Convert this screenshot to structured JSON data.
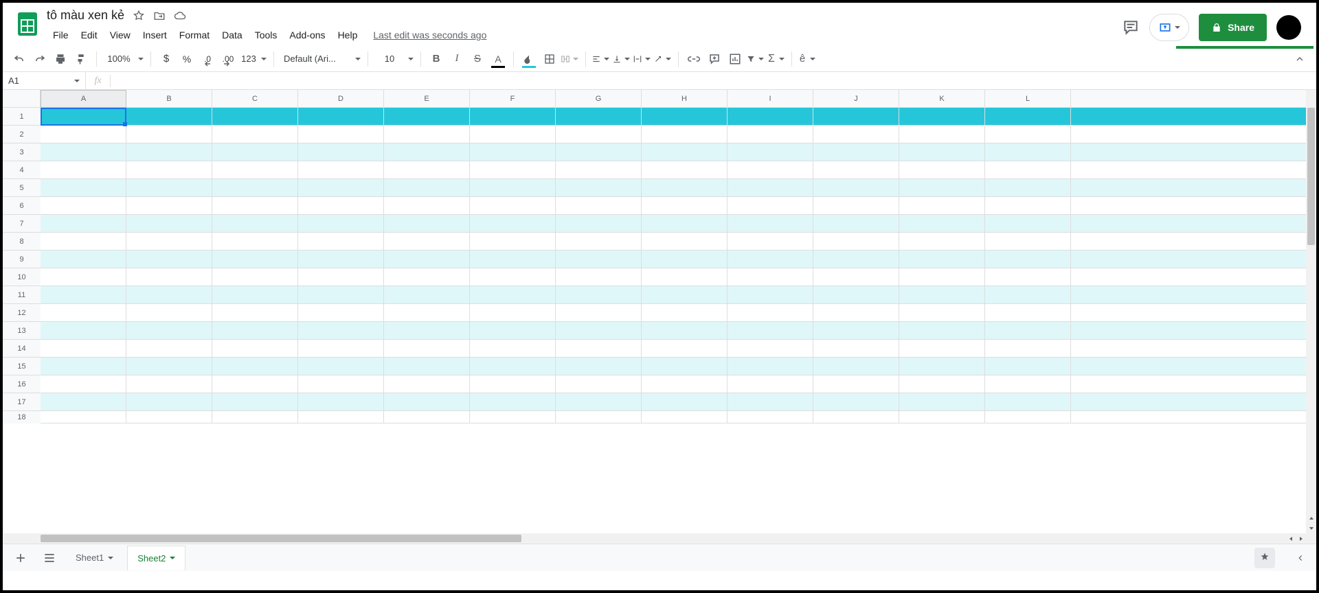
{
  "doc": {
    "title": "tô màu xen kẻ"
  },
  "menus": {
    "file": "File",
    "edit": "Edit",
    "view": "View",
    "insert": "Insert",
    "format": "Format",
    "data": "Data",
    "tools": "Tools",
    "addons": "Add-ons",
    "help": "Help"
  },
  "last_edit": "Last edit was seconds ago",
  "header_buttons": {
    "share": "Share"
  },
  "toolbar": {
    "zoom": "100%",
    "currency": "$",
    "percent": "%",
    "dec_dec": ".0",
    "inc_dec": ".00",
    "num_fmt": "123",
    "font": "Default (Ari...",
    "font_size": "10"
  },
  "icons": {
    "accent_hat": "ê",
    "text_A": "A"
  },
  "name_box": "A1",
  "fx": "",
  "columns": [
    "A",
    "B",
    "C",
    "D",
    "E",
    "F",
    "G",
    "H",
    "I",
    "J",
    "K",
    "L"
  ],
  "rows": [
    "1",
    "2",
    "3",
    "4",
    "5",
    "6",
    "7",
    "8",
    "9",
    "10",
    "11",
    "12",
    "13",
    "14",
    "15",
    "16",
    "17",
    "18"
  ],
  "sheets": {
    "tab1": "Sheet1",
    "tab2": "Sheet2"
  },
  "grid": {
    "header_row_color": "#26c6da",
    "alt_row_color": "#e0f7fa",
    "alt_pattern": "odd_rows_shaded_starting_row3",
    "selected_cell": "A1"
  }
}
